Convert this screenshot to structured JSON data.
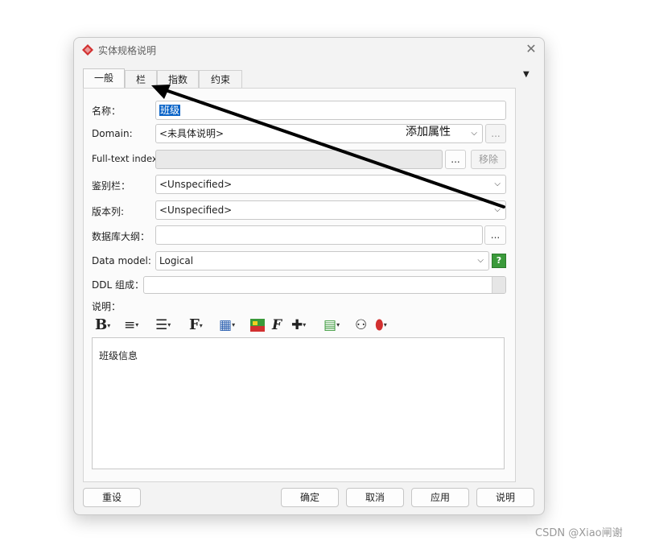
{
  "window": {
    "title": "实体规格说明"
  },
  "tabs": [
    {
      "label": "一般",
      "active": true
    },
    {
      "label": "栏",
      "active": false
    },
    {
      "label": "指数",
      "active": false
    },
    {
      "label": "约束",
      "active": false
    }
  ],
  "form": {
    "name": {
      "label": "名称：",
      "value": "班级"
    },
    "domain": {
      "label": "Domain:",
      "value": "<未具体说明>",
      "button": "..."
    },
    "fulltext": {
      "label": "Full-text index:",
      "value": "",
      "browse": "...",
      "remove": "移除"
    },
    "discriminator": {
      "label": "鉴别栏：",
      "value": "<Unspecified>"
    },
    "version": {
      "label": "版本列:",
      "value": "<Unspecified>"
    },
    "schema": {
      "label": "数据库大纲：",
      "value": "",
      "button": "..."
    },
    "datamodel": {
      "label": "Data model:",
      "value": "Logical",
      "help": "?"
    },
    "ddl": {
      "label": "DDL 组成：",
      "value": ""
    },
    "description": {
      "label": "说明：",
      "text": "班级信息"
    }
  },
  "toolbar": {
    "icons": [
      "bold-icon",
      "align-icon",
      "list-icon",
      "font-icon",
      "table-icon",
      "image-icon",
      "format-icon",
      "insert-icon",
      "paste-icon",
      "find-icon",
      "spellcheck-icon"
    ]
  },
  "buttons": {
    "reset": "重设",
    "ok": "确定",
    "cancel": "取消",
    "apply": "应用",
    "help": "说明"
  },
  "annotation": {
    "text": "添加属性"
  },
  "watermark": "CSDN @Xiao闸谢",
  "colors": {
    "selection": "#0a64c8",
    "help_green": "#3a9a3a",
    "icon_red": "#d23030"
  }
}
